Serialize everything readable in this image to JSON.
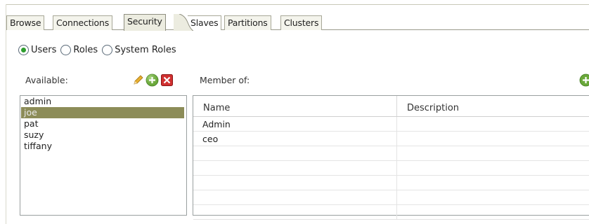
{
  "tabs": [
    {
      "label": "Browse"
    },
    {
      "label": "Connections"
    },
    {
      "label": "Security",
      "active": true
    },
    {
      "label": "Slaves"
    },
    {
      "label": "Partitions"
    },
    {
      "label": "Clusters"
    }
  ],
  "view_mode": {
    "options": [
      {
        "label": "Users",
        "checked": true
      },
      {
        "label": "Roles",
        "checked": false
      },
      {
        "label": "System Roles",
        "checked": false
      }
    ]
  },
  "available": {
    "label": "Available:",
    "items": [
      "admin",
      "joe",
      "pat",
      "suzy",
      "tiffany"
    ],
    "selected": "joe",
    "toolbar_icons": [
      "pencil-icon",
      "add-icon",
      "delete-icon"
    ]
  },
  "member_of": {
    "label": "Member of:",
    "columns": [
      "Name",
      "Description"
    ],
    "rows": [
      [
        "Admin",
        ""
      ],
      [
        "ceo",
        ""
      ],
      [
        "",
        ""
      ],
      [
        "",
        ""
      ],
      [
        "",
        ""
      ],
      [
        "",
        ""
      ],
      [
        "",
        ""
      ]
    ],
    "toolbar_icons": [
      "add-icon"
    ]
  },
  "colors": {
    "selection": "#8c8c58",
    "add_icon_green": "#6aa83a",
    "delete_icon_red": "#d03030"
  }
}
